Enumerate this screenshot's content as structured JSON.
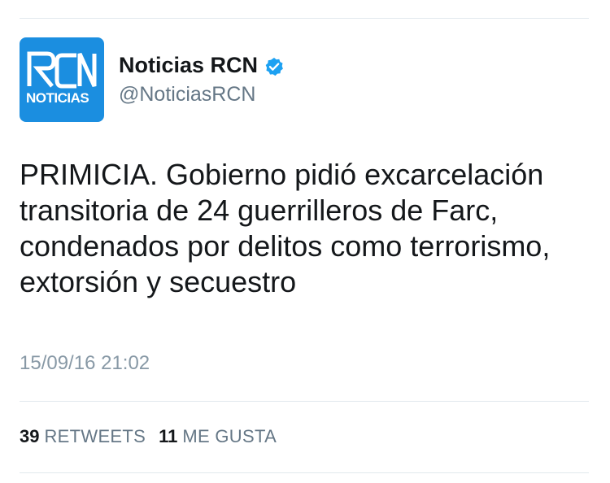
{
  "author": {
    "avatar_logo_text": "NOTICIAS",
    "display_name": "Noticias RCN",
    "handle": "@NoticiasRCN",
    "verified": true
  },
  "tweet": {
    "text": "PRIMICIA. Gobierno pidió excarcelación transitoria de 24 guerrilleros de Farc, condenados por delitos como terrorismo, extorsión y secuestro",
    "timestamp": "15/09/16 21:02"
  },
  "stats": {
    "retweets_count": "39",
    "retweets_label": "RETWEETS",
    "likes_count": "11",
    "likes_label": "ME GUSTA"
  },
  "colors": {
    "avatar_bg": "#1b8ee0",
    "verified_badge": "#1da1f2",
    "secondary_text": "#657786",
    "divider": "#e1e8ed"
  }
}
